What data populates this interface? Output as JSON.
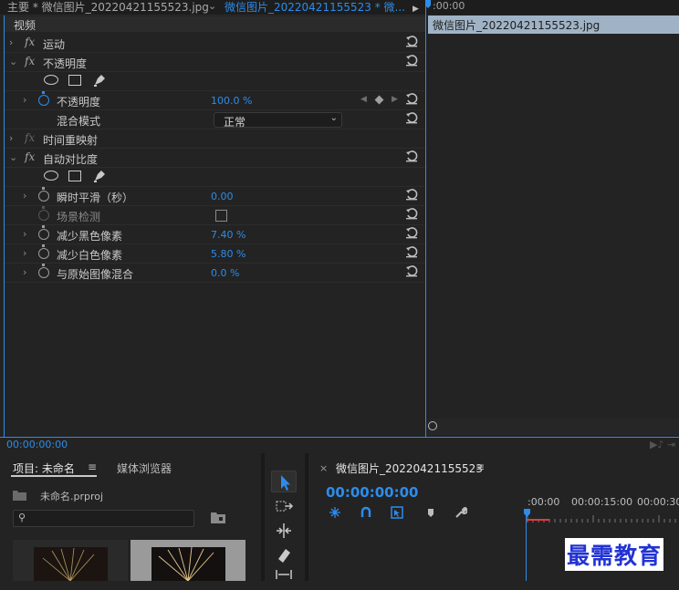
{
  "effect_controls": {
    "tabs": {
      "master": "主要 * 微信图片_20220421155523.jpg",
      "dropdown": "⌄",
      "clip": "微信图片_20220421155523 * 微...",
      "arrow": "▶"
    },
    "section_header": "视频",
    "rows": {
      "motion": "运动",
      "opacity": "不透明度",
      "opacity_param": "不透明度",
      "opacity_value": "100.0 %",
      "blend_mode": "混合模式",
      "blend_mode_value": "正常",
      "time_remap": "时间重映射",
      "auto_contrast": "自动对比度",
      "temporal_smoothing": "瞬时平滑（秒）",
      "temporal_smoothing_value": "0.00",
      "scene_detect": "场景检测",
      "black_clip": "减少黑色像素",
      "black_clip_value": "7.40 %",
      "white_clip": "减少白色像素",
      "white_clip_value": "5.80 %",
      "blend_original": "与原始图像混合",
      "blend_original_value": "0.0 %"
    },
    "fx_label": "fx",
    "timeline": {
      "ruler_time": ":00:00",
      "clip_name": "微信图片_20220421155523.jpg"
    },
    "footer_timecode": "00:00:00:00"
  },
  "project": {
    "tab": "项目: 未命名",
    "menu": "≡",
    "media_browser": "媒体浏览器",
    "project_file": "未命名.prproj",
    "search_icon_glyph": "⚲"
  },
  "sequence": {
    "close": "×",
    "title": "微信图片_20220421155523",
    "menu": "≡",
    "timecode": "00:00:00:00",
    "ruler": [
      ":00:00",
      "00:00:15:00",
      "00:00:30"
    ]
  },
  "watermark": "最需教育",
  "colors": {
    "accent": "#2d8ceb",
    "clip": "#a0b3c6",
    "playhead_red": "#e03a3a"
  }
}
